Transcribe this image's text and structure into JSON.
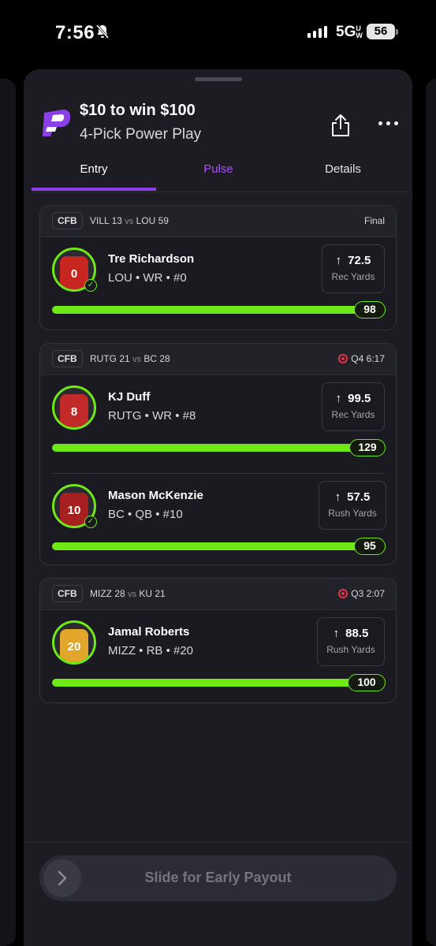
{
  "status_bar": {
    "time": "7:56",
    "network": "5G",
    "network_suffix": "UW",
    "battery": "56"
  },
  "header": {
    "title": "$10 to win $100",
    "subtitle": "4-Pick Power Play"
  },
  "tabs": [
    {
      "label": "Entry",
      "active": true
    },
    {
      "label": "Pulse",
      "active": false
    },
    {
      "label": "Details",
      "active": false
    }
  ],
  "games": [
    {
      "league": "CFB",
      "team_a": "VILL 13",
      "vs": "vs",
      "team_b": "LOU 59",
      "status": "Final",
      "live": false,
      "picks": [
        {
          "name": "Tre Richardson",
          "info": "LOU • WR • #0",
          "jersey_number": "0",
          "jersey_color": "#c7251f",
          "line": "72.5",
          "category": "Rec Yards",
          "actual": "98",
          "progress": 1.0,
          "hit": true
        }
      ]
    },
    {
      "league": "CFB",
      "team_a": "RUTG 21",
      "vs": "vs",
      "team_b": "BC 28",
      "status": "Q4 6:17",
      "live": true,
      "picks": [
        {
          "name": "KJ Duff",
          "info": "RUTG • WR • #8",
          "jersey_number": "8",
          "jersey_color": "#c22a2a",
          "line": "99.5",
          "category": "Rec Yards",
          "actual": "129",
          "progress": 1.0,
          "hit": false
        },
        {
          "name": "Mason McKenzie",
          "info": "BC • QB • #10",
          "jersey_number": "10",
          "jersey_color": "#a72020",
          "line": "57.5",
          "category": "Rush Yards",
          "actual": "95",
          "progress": 1.0,
          "hit": true
        }
      ]
    },
    {
      "league": "CFB",
      "team_a": "MIZZ 28",
      "vs": "vs",
      "team_b": "KU 21",
      "status": "Q3 2:07",
      "live": true,
      "picks": [
        {
          "name": "Jamal Roberts",
          "info": "MIZZ • RB • #20",
          "jersey_number": "20",
          "jersey_color": "#e2a72a",
          "line": "88.5",
          "category": "Rush Yards",
          "actual": "100",
          "progress": 1.0,
          "hit": false
        }
      ]
    }
  ],
  "footer": {
    "slider_label": "Slide for Early Payout"
  },
  "colors": {
    "accent": "#8b3fe8",
    "progress": "#6ee915",
    "live": "#e5334a"
  }
}
